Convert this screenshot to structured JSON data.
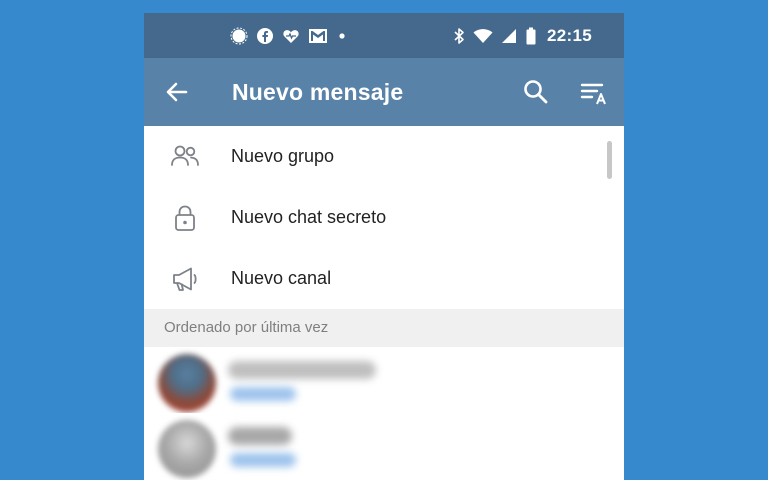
{
  "status_bar": {
    "time": "22:15",
    "notification_icons": [
      "signal-app-icon",
      "facebook-icon",
      "health-heart-icon",
      "gmail-icon",
      "more-dot-icon"
    ],
    "system_icons": [
      "bluetooth-icon",
      "wifi-icon",
      "cell-signal-icon",
      "battery-icon"
    ]
  },
  "app_bar": {
    "title": "Nuevo mensaje"
  },
  "menu": {
    "items": [
      {
        "label": "Nuevo grupo",
        "icon": "group-icon"
      },
      {
        "label": "Nuevo chat secreto",
        "icon": "lock-icon"
      },
      {
        "label": "Nuevo canal",
        "icon": "megaphone-icon"
      }
    ]
  },
  "contacts": {
    "section_label": "Ordenado por última vez"
  },
  "colors": {
    "background": "#3589cc",
    "status_bar": "#45698c",
    "app_bar": "#5982a8",
    "section_header": "#f0f0f0",
    "blurred_status": "#9dc3ec"
  }
}
